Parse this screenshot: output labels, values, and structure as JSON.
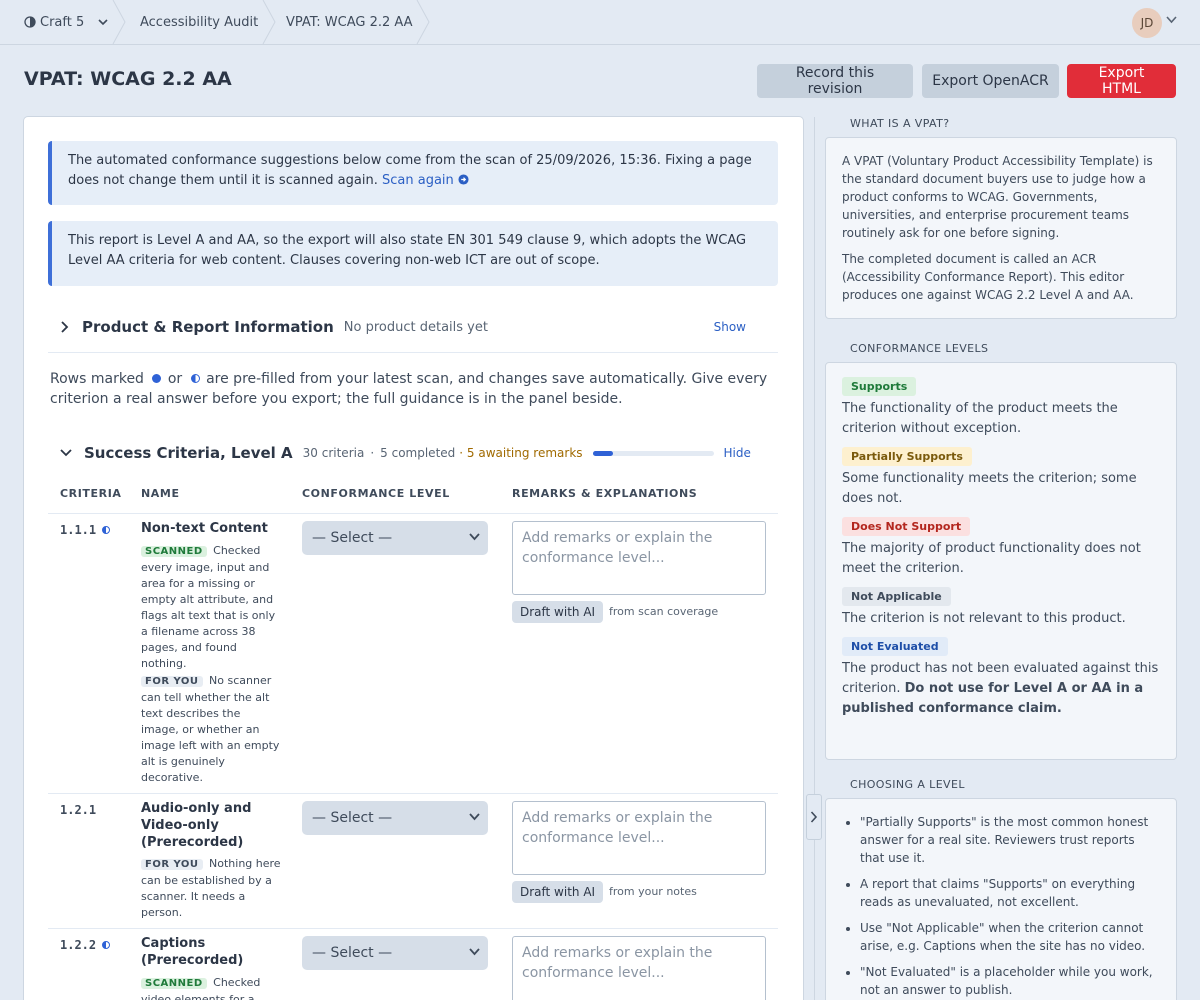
{
  "breadcrumb": {
    "items": [
      "Craft 5",
      "Accessibility Audit",
      "VPAT: WCAG 2.2 AA"
    ],
    "avatar_initials": "JD"
  },
  "header": {
    "title": "VPAT: WCAG 2.2 AA",
    "record_label": "Record this revision",
    "export_openacr_label": "Export OpenACR",
    "export_html_label": "Export HTML"
  },
  "notices": {
    "scan_text": "The automated conformance suggestions below come from the scan of 25/09/2026, 15:36. Fixing a page does not change them until it is scanned again.",
    "scan_link": "Scan again",
    "en_text": "This report is Level A and AA, so the export will also state EN 301 549 clause 9, which adopts the WCAG Level AA criteria for web content. Clauses covering non-web ICT are out of scope."
  },
  "product_section": {
    "title": "Product & Report Information",
    "subtitle": "No product details yet",
    "toggle": "Show"
  },
  "intro": {
    "before": "Rows marked",
    "middle": "or",
    "after": "are pre-filled from your latest scan, and changes save automatically. Give every criterion a real answer before you export; the full guidance is in the panel beside."
  },
  "level_a": {
    "title": "Success Criteria, Level A",
    "count": "30 criteria",
    "sep": "·",
    "completed": "5 completed",
    "awaiting": "· 5 awaiting remarks",
    "progress": 0.167,
    "toggle": "Hide"
  },
  "table": {
    "headers": [
      "CRITERIA",
      "NAME",
      "CONFORMANCE LEVEL",
      "REMARKS & EXPLANATIONS"
    ],
    "select_placeholder": "— Select —",
    "remarks_placeholder": "Add remarks or explain the conformance level...",
    "draft_label": "Draft with AI",
    "rows": [
      {
        "num": "1.1.1",
        "name": "Non-text Content",
        "scanned_tag": "SCANNED",
        "scanned_note": "Checked every image, input and area for a missing or empty alt attribute, and flags alt text that is only a filename across 38 pages, and found nothing.",
        "you_tag": "FOR YOU",
        "you_note": "No scanner can tell whether the alt text describes the image, or whether an image left with an empty alt is genuinely decorative.",
        "draft_note": "from scan coverage"
      },
      {
        "num": "1.2.1",
        "name": "Audio-only and Video-only (Prerecorded)",
        "you_tag": "FOR YOU",
        "you_note": "Nothing here can be established by a scanner. It needs a person.",
        "draft_note": "from your notes"
      },
      {
        "num": "1.2.2",
        "name": "Captions (Prerecorded)",
        "scanned_tag": "SCANNED",
        "scanned_note": "Checked video elements for a"
      }
    ]
  },
  "side": {
    "what_heading": "WHAT IS A VPAT?",
    "what_p1": "A VPAT (Voluntary Product Accessibility Template) is the standard document buyers use to judge how a product conforms to WCAG. Governments, universities, and enterprise procurement teams routinely ask for one before signing.",
    "what_p2": "The completed document is called an ACR (Accessibility Conformance Report). This editor produces one against WCAG 2.2 Level A and AA.",
    "levels_heading": "CONFORMANCE LEVELS",
    "levels": [
      {
        "label": "Supports",
        "desc": "The functionality of the product meets the criterion without exception.",
        "bg": "#dbf1df",
        "fg": "#1f7a3a"
      },
      {
        "label": "Partially Supports",
        "desc": "Some functionality meets the criterion; some does not.",
        "bg": "#fdf0cf",
        "fg": "#7a5a0c"
      },
      {
        "label": "Does Not Support",
        "desc": "The majority of product functionality does not meet the criterion.",
        "bg": "#fbe0e0",
        "fg": "#b3261e"
      },
      {
        "label": "Not Applicable",
        "desc": "The criterion is not relevant to this product.",
        "bg": "#e3e8ee",
        "fg": "#3f4b5b"
      },
      {
        "label": "Not Evaluated",
        "desc": "The product has not been evaluated against this criterion.",
        "desc_bold": "Do not use for Level A or AA in a published conformance claim.",
        "bg": "#e1ebf8",
        "fg": "#1f4fa8"
      }
    ],
    "choosing_heading": "CHOOSING A LEVEL",
    "tips": [
      "\"Partially Supports\" is the most common honest answer for a real site. Reviewers trust reports that use it.",
      "A report that claims \"Supports\" on everything reads as unevaluated, not excellent.",
      "Use \"Not Applicable\" when the criterion cannot arise, e.g. Captions when the site has no video.",
      "\"Not Evaluated\" is a placeholder while you work, not an answer to publish."
    ]
  },
  "colors": {
    "accent": "#2f62d6",
    "danger": "#e12d39",
    "awaiting": "#a06a00"
  }
}
